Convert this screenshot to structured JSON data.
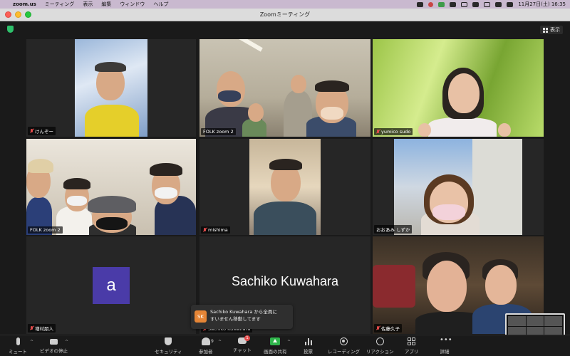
{
  "menubar": {
    "app_name": "zoom.us",
    "items": [
      "ミーティング",
      "表示",
      "編集",
      "ウィンドウ",
      "ヘルプ"
    ],
    "clock": "11月27日(土)  16:35"
  },
  "window": {
    "title": "Zoomミーティング"
  },
  "meeting": {
    "view_label": "表示"
  },
  "participants": [
    {
      "name": "けんぞー",
      "muted": true
    },
    {
      "name": "FOLK zoom 2",
      "muted": false
    },
    {
      "name": "yumico sudo",
      "muted": true
    },
    {
      "name": "FOLK zoom 2",
      "muted": false
    },
    {
      "name": "mishima",
      "muted": true
    },
    {
      "name": "おおあみ しずか",
      "muted": false
    },
    {
      "name": "増村朋人",
      "muted": true,
      "avatar_letter": "a"
    },
    {
      "name": "Sachiko Kuwahara",
      "muted": true,
      "display_name": "Sachiko Kuwahara"
    },
    {
      "name": "佐藤久子",
      "muted": true
    }
  ],
  "notification": {
    "avatar_initials": "SK",
    "line1": "Sachiko Kuwahara から全員に",
    "line2": "すいません移動してます"
  },
  "toolbar": {
    "mute": "ミュート",
    "stop_video": "ビデオの停止",
    "security": "セキュリティ",
    "participants": "参加者",
    "participant_count": "9",
    "chat": "チャット",
    "chat_badge": "1",
    "share": "画面の共有",
    "poll": "投票",
    "record": "レコーディング",
    "reactions": "リアクション",
    "apps": "アプリ",
    "more": "詳細"
  },
  "colors": {
    "active_speaker_border": "#d8d27a",
    "share_green": "#2fb54b",
    "avatar_purple": "#4a3ba8",
    "notif_avatar": "#e58536"
  }
}
